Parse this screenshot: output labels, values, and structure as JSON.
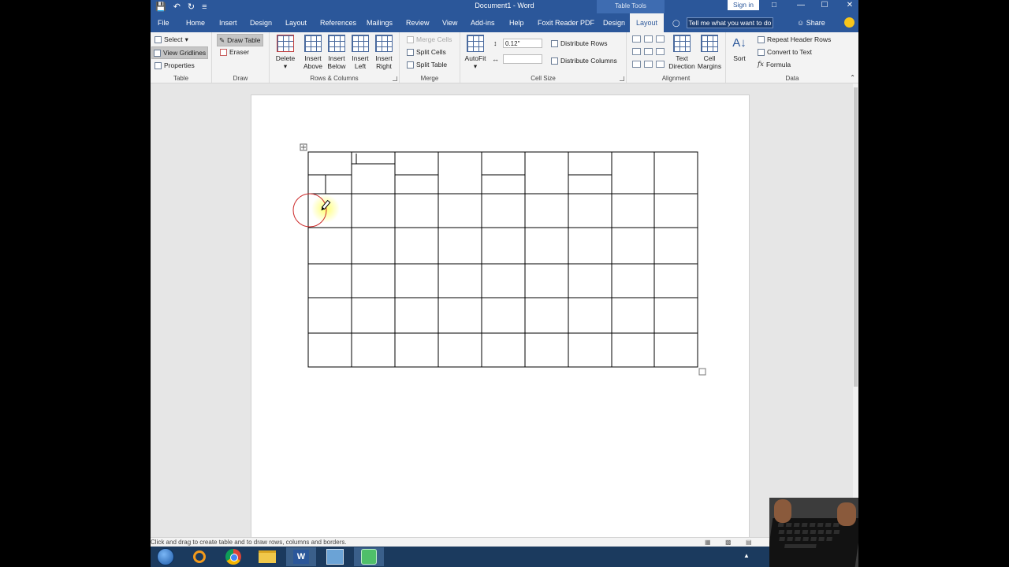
{
  "window": {
    "title": "Document1  -  Word",
    "context_tab_group": "Table Tools",
    "sign_in": "Sign in"
  },
  "tabs": [
    "File",
    "Home",
    "Insert",
    "Design",
    "Layout",
    "References",
    "Mailings",
    "Review",
    "View",
    "Add-ins",
    "Help",
    "Foxit Reader PDF",
    "Design",
    "Layout"
  ],
  "active_tab": "Layout",
  "tell_me": "Tell me what you want to do",
  "share": "Share",
  "ribbon": {
    "table": {
      "label": "Table",
      "select": "Select",
      "view_gridlines": "View Gridlines",
      "properties": "Properties"
    },
    "draw": {
      "label": "Draw",
      "draw_table": "Draw Table",
      "eraser": "Eraser"
    },
    "rows_columns": {
      "label": "Rows & Columns",
      "delete": "Delete",
      "insert_above": [
        "Insert",
        "Above"
      ],
      "insert_below": [
        "Insert",
        "Below"
      ],
      "insert_left": [
        "Insert",
        "Left"
      ],
      "insert_right": [
        "Insert",
        "Right"
      ]
    },
    "merge": {
      "label": "Merge",
      "merge_cells": "Merge Cells",
      "split_cells": "Split Cells",
      "split_table": "Split Table"
    },
    "cell_size": {
      "label": "Cell Size",
      "autofit": "AutoFit",
      "height_value": "0.12\"",
      "width_value": "",
      "distribute_rows": "Distribute Rows",
      "distribute_columns": "Distribute Columns"
    },
    "alignment": {
      "label": "Alignment",
      "text_direction": [
        "Text",
        "Direction"
      ],
      "cell_margins": [
        "Cell",
        "Margins"
      ]
    },
    "data": {
      "label": "Data",
      "sort": "Sort",
      "repeat_header_rows": "Repeat Header Rows",
      "convert_to_text": "Convert to Text",
      "formula": "Formula"
    }
  },
  "status_bar": {
    "text": "Click and drag to create table and to draw rows, columns and borders."
  },
  "table": {
    "columns": 9,
    "rows": 6,
    "cursor": "pencil"
  },
  "colors": {
    "title_bar": "#2b579a",
    "ribbon": "#f3f3f3",
    "taskbar": "#1b3a5e",
    "cursor_highlight": "#ffff66",
    "click_ring": "#cc2a2a"
  }
}
